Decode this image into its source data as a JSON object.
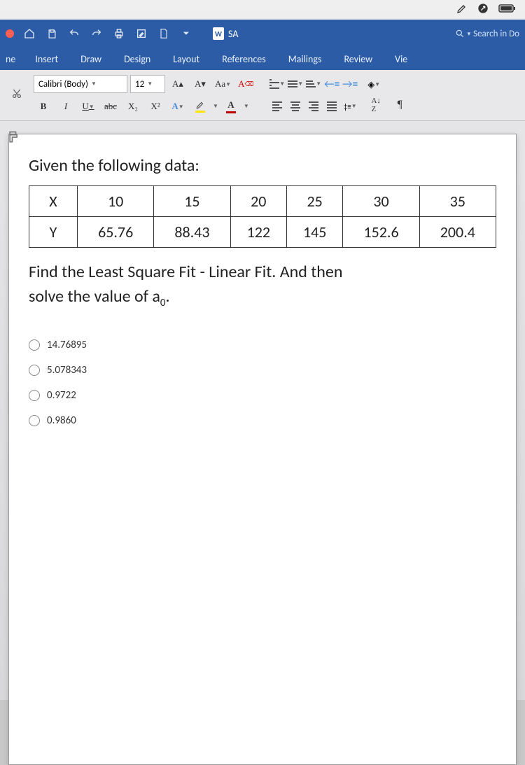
{
  "menubar": {},
  "titlebar": {
    "doc_name": "SA",
    "search_placeholder": "Search in Do"
  },
  "tabs": [
    "Insert",
    "Draw",
    "Design",
    "Layout",
    "References",
    "Mailings",
    "Review",
    "Vie"
  ],
  "tabs_prefix": "ne",
  "ribbon": {
    "font_name": "Calibri (Body)",
    "font_size": "12",
    "btn_bold": "B",
    "btn_italic": "I",
    "btn_underline": "U",
    "btn_strike": "abc",
    "btn_sub": "X₂",
    "btn_sup": "X²",
    "btn_inc": "A▴",
    "btn_dec": "A▾",
    "btn_change_case": "Aa",
    "btn_outline": "A",
    "btn_fontcolor": "A",
    "btn_az": "A̲Z̲↓",
    "btn_pilcrow": "¶"
  },
  "question": {
    "title": "Given the following data:",
    "row_x_label": "X",
    "row_y_label": "Y",
    "x": [
      "10",
      "15",
      "20",
      "25",
      "30",
      "35"
    ],
    "y": [
      "65.76",
      "88.43",
      "122",
      "145",
      "152.6",
      "200.4"
    ],
    "prompt_line1": "Find the Least Square Fit - Linear Fit. And then",
    "prompt_line2_pre": "solve the value of a",
    "prompt_line2_sub": "0",
    "prompt_line2_post": "."
  },
  "options": [
    "14.76895",
    "5.078343",
    "0.9722",
    "0.9860"
  ]
}
